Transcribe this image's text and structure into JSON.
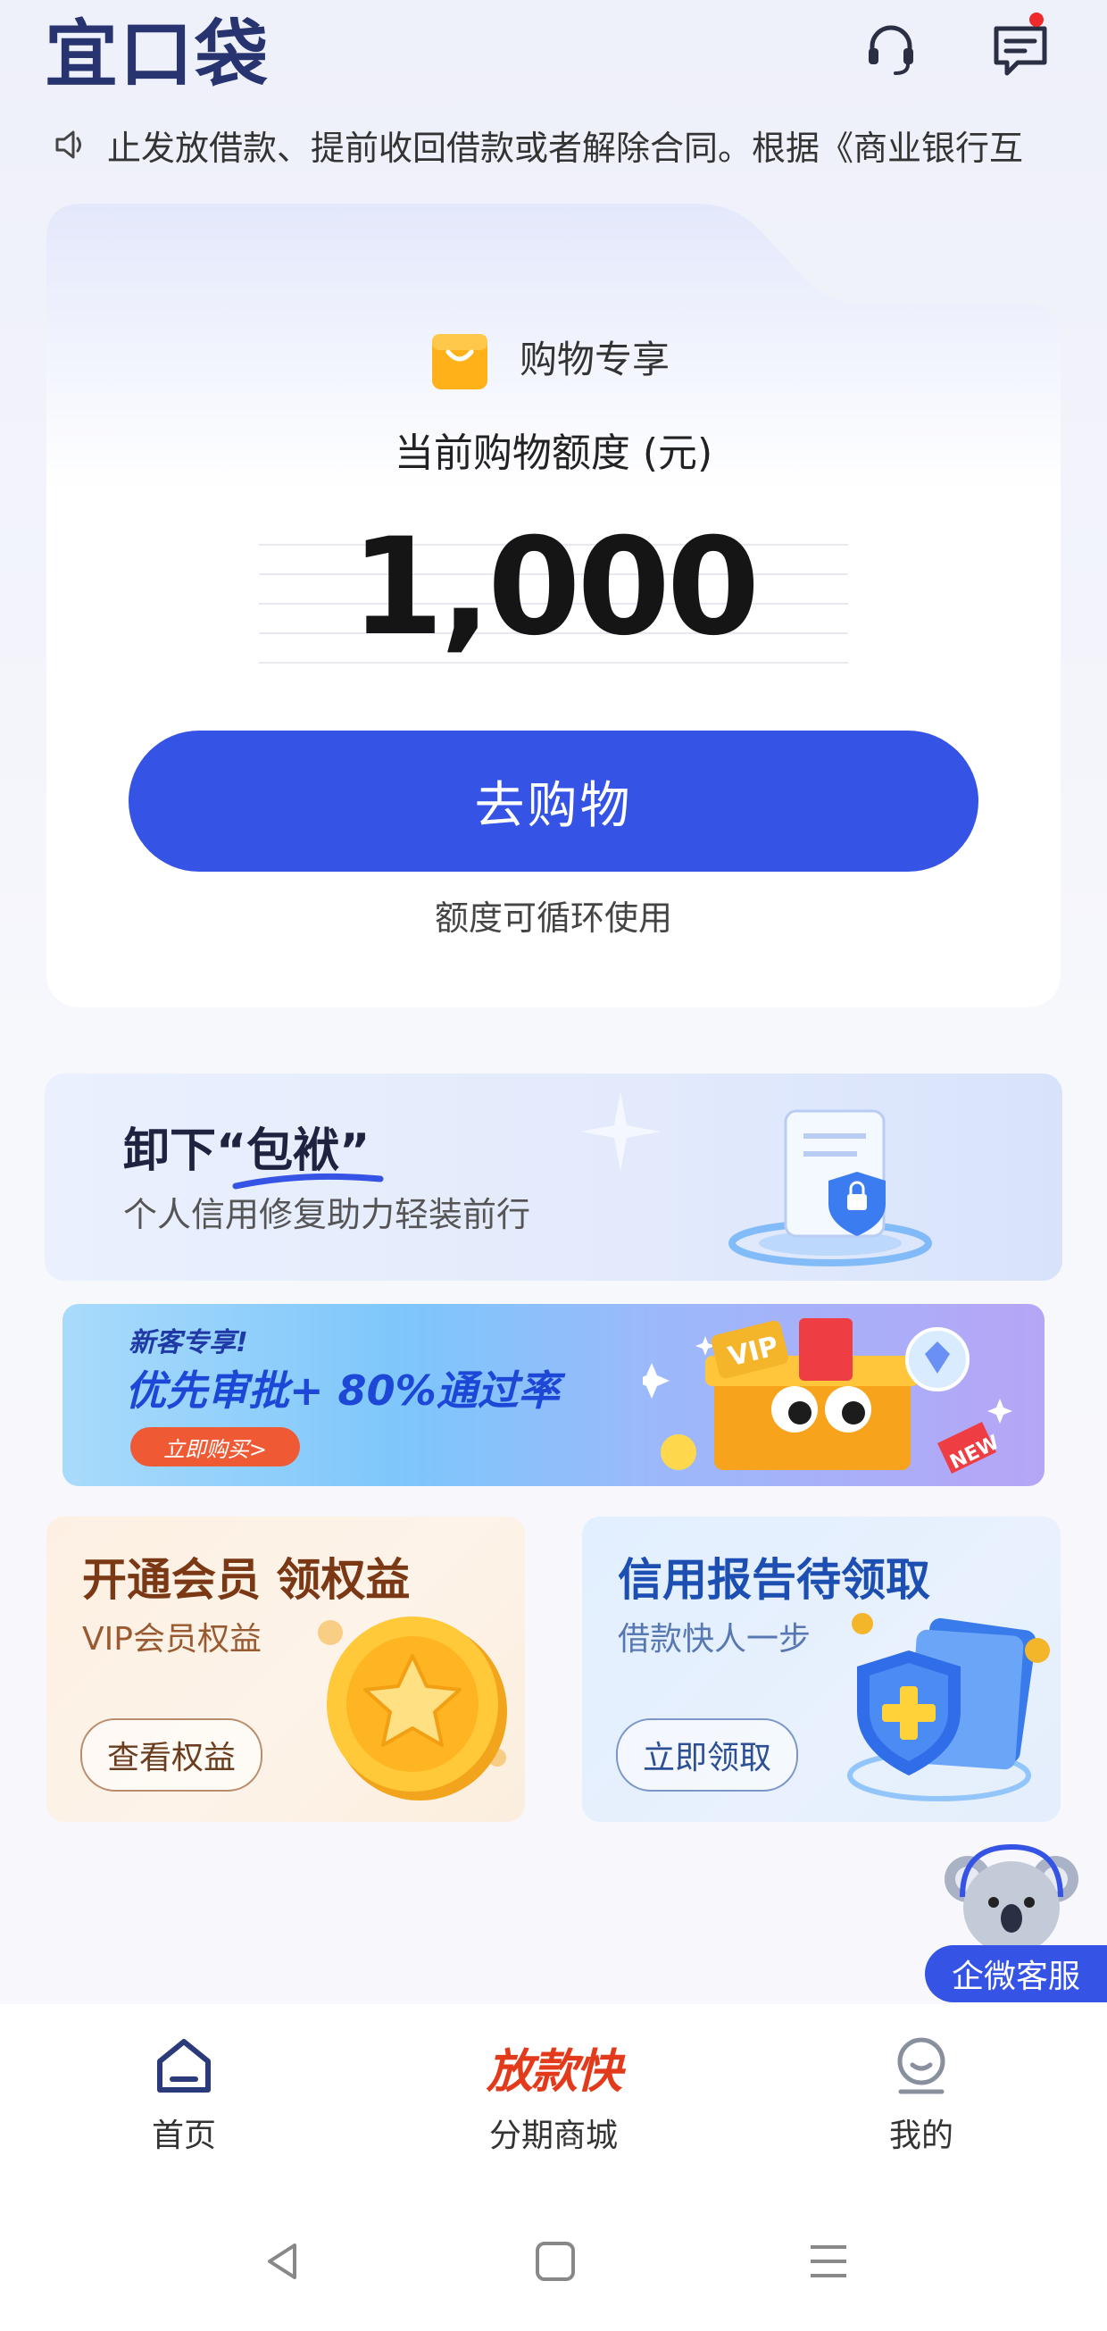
{
  "header": {
    "logo_text": "宜口袋",
    "headset_icon": "headset-icon",
    "message_icon": "message-icon",
    "has_unread_dot": true
  },
  "notice": {
    "icon": "speaker-icon",
    "text": "止发放借款、提前收回借款或者解除合同。根据《商业银行互"
  },
  "credit_card": {
    "tag_icon": "shopping-bag-icon",
    "tag_label": "购物专享",
    "label": "当前购物额度 (元)",
    "amount": "1,000",
    "button_label": "去购物",
    "note": "额度可循环使用"
  },
  "banner_repair": {
    "title": "卸下“包袱”",
    "subtitle": "个人信用修复助力轻装前行"
  },
  "banner_promo": {
    "small": "新客专享!",
    "headline": "优先审批+ 80%通过率",
    "button": "立即购买>",
    "art_badges": [
      "VIP",
      "NEW"
    ]
  },
  "vip_card": {
    "title": "开通会员  领权益",
    "subtitle": "VIP会员权益",
    "button": "查看权益"
  },
  "report_card": {
    "title": "信用报告待领取",
    "subtitle": "借款快人一步",
    "button": "立即领取"
  },
  "service": {
    "label": "企微客服"
  },
  "bottom_nav": {
    "items": [
      {
        "label": "首页",
        "icon": "home-icon",
        "active": true
      },
      {
        "label": "分期商城",
        "icon": "fast-loan-badge",
        "badge_text": "放款快"
      },
      {
        "label": "我的",
        "icon": "profile-icon"
      }
    ]
  },
  "colors": {
    "primary": "#3553e4",
    "logo": "#28346f",
    "promo_orange": "#ef5a35"
  }
}
